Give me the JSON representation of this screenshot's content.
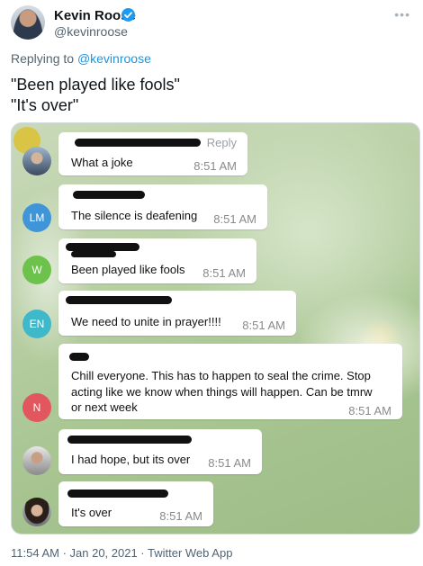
{
  "author": {
    "name": "Kevin Roose",
    "handle": "@kevinroose"
  },
  "replying": {
    "prefix": "Replying to",
    "target": "@kevinroose"
  },
  "tweet": {
    "lines": [
      "\"Been played like fools\"",
      "\"It's over\""
    ]
  },
  "chat": {
    "ghost_reply": "Reply",
    "messages": [
      {
        "avatar": "",
        "text": "What a joke",
        "time": "8:51 AM"
      },
      {
        "avatar": "LM",
        "avatar_color": "#3f95d8",
        "text": "The silence is deafening",
        "time": "8:51 AM"
      },
      {
        "avatar": "W",
        "avatar_color": "#6cc24a",
        "text": "Been played like fools",
        "time": "8:51 AM"
      },
      {
        "avatar": "EN",
        "avatar_color": "#3fb8c9",
        "text": "We need to unite in prayer!!!!",
        "time": "8:51 AM"
      },
      {
        "avatar": "N",
        "avatar_color": "#e2565d",
        "text_lines": [
          "Chill everyone. This has to happen to seal the crime. Stop",
          "acting like we know when things will happen. Can be tmrw",
          "or next week"
        ],
        "time": "8:51 AM"
      },
      {
        "avatar": "",
        "text": "I had hope, but its over",
        "time": "8:51 AM"
      },
      {
        "avatar": "",
        "text": "It's over",
        "time": "8:51 AM"
      }
    ]
  },
  "footer": {
    "meta": "11:54 AM · Jan 20, 2021 · Twitter Web App"
  },
  "colors": {
    "link": "#1b95e0",
    "verified": "#1d9bf0"
  }
}
